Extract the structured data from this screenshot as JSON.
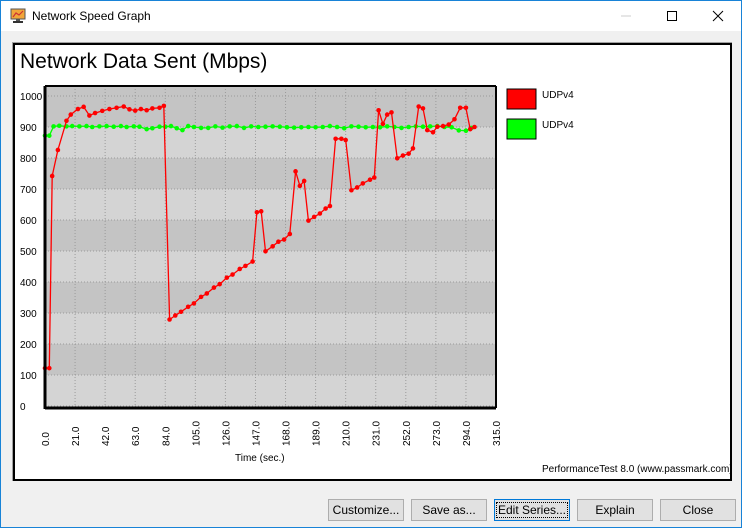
{
  "window": {
    "title": "Network Speed Graph",
    "icon": "passmark-app-icon"
  },
  "window_controls": [
    "minimize-icon",
    "maximize-icon",
    "close-icon"
  ],
  "chart_data": {
    "type": "line",
    "title": "Network Data Sent (Mbps)",
    "xlabel": "Time (sec.)",
    "ylabel": "",
    "xlim": [
      0,
      315
    ],
    "ylim": [
      0,
      1000
    ],
    "xticks": [
      "0.0",
      "21.0",
      "42.0",
      "63.0",
      "84.0",
      "105.0",
      "126.0",
      "147.0",
      "168.0",
      "189.0",
      "210.0",
      "231.0",
      "252.0",
      "273.0",
      "294.0",
      "315.0"
    ],
    "yticks": [
      "0",
      "100",
      "200",
      "300",
      "400",
      "500",
      "600",
      "700",
      "800",
      "900",
      "1000"
    ],
    "grid": true,
    "legend_position": "right",
    "series": [
      {
        "name": "UDPv4",
        "color": "#ff0000",
        "points": [
          [
            0,
            122
          ],
          [
            3,
            122
          ],
          [
            5,
            742
          ],
          [
            9,
            826
          ],
          [
            15,
            920
          ],
          [
            18,
            940
          ],
          [
            23,
            958
          ],
          [
            27,
            965
          ],
          [
            31,
            937
          ],
          [
            35,
            945
          ],
          [
            40,
            952
          ],
          [
            45,
            958
          ],
          [
            50,
            962
          ],
          [
            55,
            966
          ],
          [
            59,
            957
          ],
          [
            63,
            953
          ],
          [
            67,
            958
          ],
          [
            71,
            954
          ],
          [
            75,
            960
          ],
          [
            80,
            962
          ],
          [
            83,
            968
          ],
          [
            87,
            279
          ],
          [
            91,
            292
          ],
          [
            95,
            304
          ],
          [
            100,
            320
          ],
          [
            104,
            331
          ],
          [
            109,
            352
          ],
          [
            113,
            363
          ],
          [
            118,
            382
          ],
          [
            122,
            393
          ],
          [
            127,
            414
          ],
          [
            131,
            424
          ],
          [
            136,
            442
          ],
          [
            140,
            452
          ],
          [
            145,
            466
          ],
          [
            148,
            625
          ],
          [
            151,
            628
          ],
          [
            154,
            499
          ],
          [
            159,
            515
          ],
          [
            163,
            530
          ],
          [
            167,
            537
          ],
          [
            171,
            555
          ],
          [
            175,
            757
          ],
          [
            178,
            710
          ],
          [
            181,
            726
          ],
          [
            184,
            598
          ],
          [
            188,
            610
          ],
          [
            192,
            621
          ],
          [
            196,
            637
          ],
          [
            199,
            645
          ],
          [
            203,
            862
          ],
          [
            207,
            862
          ],
          [
            210,
            858
          ],
          [
            214,
            696
          ],
          [
            218,
            705
          ],
          [
            222,
            718
          ],
          [
            227,
            730
          ],
          [
            230,
            737
          ],
          [
            233,
            954
          ],
          [
            236,
            910
          ],
          [
            239,
            940
          ],
          [
            242,
            947
          ],
          [
            246,
            799
          ],
          [
            250,
            808
          ],
          [
            254,
            814
          ],
          [
            257,
            831
          ],
          [
            261,
            966
          ],
          [
            264,
            960
          ],
          [
            267,
            890
          ],
          [
            271,
            883
          ],
          [
            274,
            901
          ],
          [
            278,
            903
          ],
          [
            282,
            908
          ],
          [
            286,
            925
          ],
          [
            290,
            962
          ],
          [
            294,
            962
          ],
          [
            297,
            893
          ],
          [
            300,
            900
          ]
        ]
      },
      {
        "name": "UDPv4",
        "color": "#00ff00",
        "points": [
          [
            0,
            872
          ],
          [
            3,
            872
          ],
          [
            6,
            902
          ],
          [
            10,
            904
          ],
          [
            15,
            902
          ],
          [
            19,
            903
          ],
          [
            24,
            902
          ],
          [
            29,
            903
          ],
          [
            33,
            900
          ],
          [
            38,
            902
          ],
          [
            43,
            903
          ],
          [
            48,
            901
          ],
          [
            53,
            903
          ],
          [
            57,
            900
          ],
          [
            62,
            902
          ],
          [
            66,
            901
          ],
          [
            71,
            893
          ],
          [
            75,
            896
          ],
          [
            80,
            901
          ],
          [
            84,
            901
          ],
          [
            88,
            903
          ],
          [
            92,
            896
          ],
          [
            96,
            890
          ],
          [
            100,
            903
          ],
          [
            104,
            900
          ],
          [
            109,
            897
          ],
          [
            114,
            897
          ],
          [
            119,
            902
          ],
          [
            124,
            898
          ],
          [
            129,
            902
          ],
          [
            134,
            903
          ],
          [
            139,
            897
          ],
          [
            144,
            902
          ],
          [
            149,
            900
          ],
          [
            154,
            901
          ],
          [
            159,
            902
          ],
          [
            164,
            901
          ],
          [
            169,
            899
          ],
          [
            174,
            898
          ],
          [
            179,
            899
          ],
          [
            184,
            900
          ],
          [
            189,
            899
          ],
          [
            194,
            900
          ],
          [
            199,
            903
          ],
          [
            204,
            900
          ],
          [
            209,
            896
          ],
          [
            214,
            902
          ],
          [
            219,
            901
          ],
          [
            224,
            899
          ],
          [
            229,
            900
          ],
          [
            234,
            899
          ],
          [
            239,
            902
          ],
          [
            244,
            900
          ],
          [
            249,
            897
          ],
          [
            254,
            900
          ],
          [
            259,
            902
          ],
          [
            264,
            901
          ],
          [
            269,
            902
          ],
          [
            274,
            903
          ],
          [
            279,
            900
          ],
          [
            284,
            899
          ],
          [
            289,
            889
          ],
          [
            294,
            888
          ],
          [
            298,
            897
          ]
        ]
      }
    ]
  },
  "credit": "PerformanceTest 8.0 (www.passmark.com)",
  "buttons": {
    "customize": "Customize...",
    "save_as": "Save as...",
    "edit_series": "Edit Series...",
    "explain": "Explain",
    "close": "Close"
  }
}
